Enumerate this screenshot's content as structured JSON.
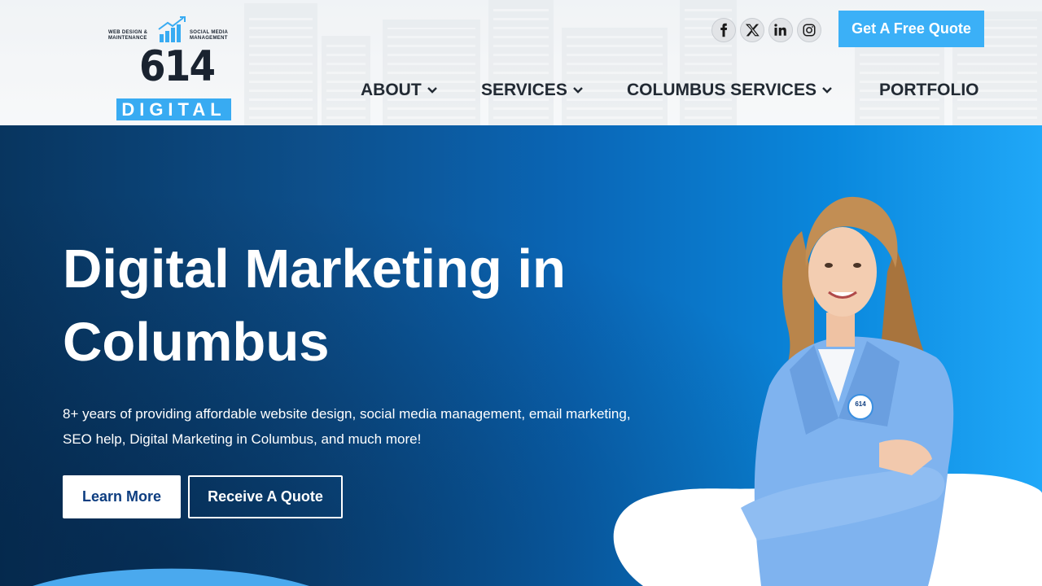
{
  "brand": {
    "tagline_left": "WEB DESIGN & MAINTENANCE",
    "tagline_right": "SOCIAL MEDIA MANAGEMENT",
    "number": "614",
    "word": "DIGITAL",
    "accent_color": "#38abf2"
  },
  "socials": [
    {
      "name": "facebook",
      "icon": "facebook-icon"
    },
    {
      "name": "x",
      "icon": "x-icon"
    },
    {
      "name": "linkedin",
      "icon": "linkedin-icon"
    },
    {
      "name": "instagram",
      "icon": "instagram-icon"
    }
  ],
  "header": {
    "cta_label": "Get A Free Quote"
  },
  "nav": {
    "items": [
      {
        "label": "ABOUT",
        "has_dropdown": true
      },
      {
        "label": "SERVICES",
        "has_dropdown": true
      },
      {
        "label": "COLUMBUS SERVICES",
        "has_dropdown": true
      },
      {
        "label": "PORTFOLIO",
        "has_dropdown": false
      }
    ]
  },
  "hero": {
    "title": "Digital Marketing in Columbus",
    "description": "8+ years of providing affordable website design, social media management, email marketing, SEO help, Digital Marketing in Columbus, and much more!",
    "primary_button": "Learn More",
    "secondary_button": "Receive A Quote",
    "badge_text": "614"
  }
}
